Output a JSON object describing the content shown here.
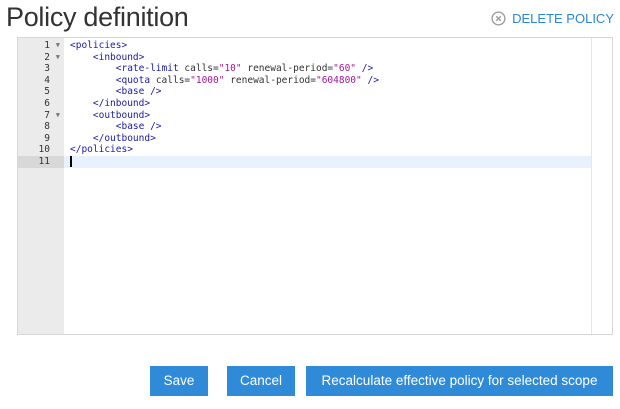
{
  "header": {
    "title": "Policy definition",
    "delete_label": "DELETE POLICY",
    "delete_icon": "close-circle-icon"
  },
  "editor": {
    "active_line": 11,
    "lines": [
      {
        "num": "1",
        "fold": true,
        "tokens": [
          {
            "t": "tag",
            "v": "<policies>"
          }
        ]
      },
      {
        "num": "2",
        "fold": true,
        "tokens": [
          {
            "t": "plain",
            "v": "    "
          },
          {
            "t": "tag",
            "v": "<inbound>"
          }
        ]
      },
      {
        "num": "3",
        "fold": false,
        "tokens": [
          {
            "t": "plain",
            "v": "        "
          },
          {
            "t": "tag",
            "v": "<rate-limit"
          },
          {
            "t": "attr",
            "v": " calls="
          },
          {
            "t": "str",
            "v": "\"10\""
          },
          {
            "t": "attr",
            "v": " renewal-period="
          },
          {
            "t": "str",
            "v": "\"60\""
          },
          {
            "t": "tag",
            "v": " />"
          }
        ]
      },
      {
        "num": "4",
        "fold": false,
        "tokens": [
          {
            "t": "plain",
            "v": "        "
          },
          {
            "t": "tag",
            "v": "<quota"
          },
          {
            "t": "attr",
            "v": " calls="
          },
          {
            "t": "str",
            "v": "\"1000\""
          },
          {
            "t": "attr",
            "v": " renewal-period="
          },
          {
            "t": "str",
            "v": "\"604800\""
          },
          {
            "t": "tag",
            "v": " />"
          }
        ]
      },
      {
        "num": "5",
        "fold": false,
        "tokens": [
          {
            "t": "plain",
            "v": "        "
          },
          {
            "t": "tag",
            "v": "<base />"
          }
        ]
      },
      {
        "num": "6",
        "fold": false,
        "tokens": [
          {
            "t": "plain",
            "v": "    "
          },
          {
            "t": "tag",
            "v": "</inbound>"
          }
        ]
      },
      {
        "num": "7",
        "fold": true,
        "tokens": [
          {
            "t": "plain",
            "v": "    "
          },
          {
            "t": "tag",
            "v": "<outbound>"
          }
        ]
      },
      {
        "num": "8",
        "fold": false,
        "tokens": [
          {
            "t": "plain",
            "v": "        "
          },
          {
            "t": "tag",
            "v": "<base />"
          }
        ]
      },
      {
        "num": "9",
        "fold": false,
        "tokens": [
          {
            "t": "plain",
            "v": "    "
          },
          {
            "t": "tag",
            "v": "</outbound>"
          }
        ]
      },
      {
        "num": "10",
        "fold": false,
        "tokens": [
          {
            "t": "tag",
            "v": "</policies>"
          }
        ]
      },
      {
        "num": "11",
        "fold": false,
        "tokens": []
      }
    ]
  },
  "buttons": {
    "save": "Save",
    "cancel": "Cancel",
    "recalculate": "Recalculate effective policy for selected scope"
  },
  "colors": {
    "accent": "#2f8bd8",
    "link": "#2a86d6",
    "tag": "#1a1aa6",
    "string": "#a31595"
  }
}
